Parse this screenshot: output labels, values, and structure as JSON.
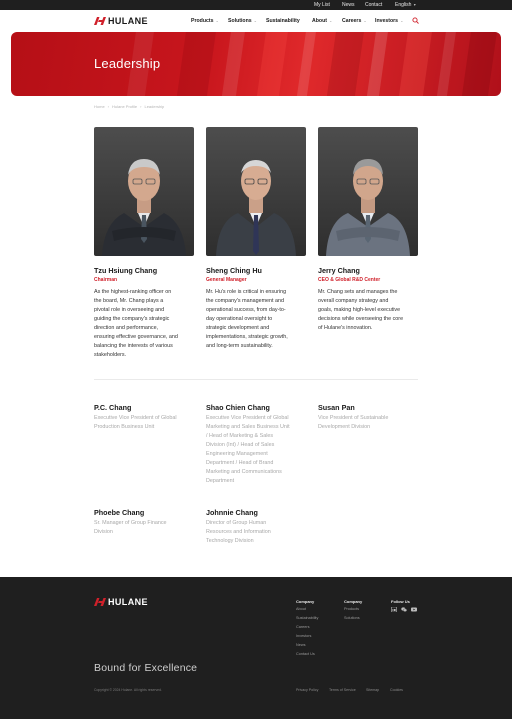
{
  "utility_bar": {
    "links": [
      "My List",
      "News",
      "Contact"
    ],
    "language": "English"
  },
  "brand": {
    "logo_text": "HULANE",
    "accent": "#d0202a"
  },
  "nav": {
    "items": [
      {
        "label": "Products",
        "has_menu": true
      },
      {
        "label": "Solutions",
        "has_menu": true
      },
      {
        "label": "Sustainability",
        "has_menu": false
      },
      {
        "label": "About",
        "has_menu": true
      },
      {
        "label": "Careers",
        "has_menu": true
      },
      {
        "label": "Investors",
        "has_menu": true
      }
    ],
    "search_icon": "search-icon"
  },
  "hero": {
    "title": "Leadership"
  },
  "breadcrumb": [
    "Home",
    "Hulane Profile",
    "Leadership"
  ],
  "leaders": [
    {
      "name": "Tzu Hsiung Chang",
      "role": "Chairman",
      "description_lines": [
        "As the highest-ranking officer on",
        "the board, Mr. Chang plays a",
        "pivotal role in overseeing and",
        "guiding the company's strategic",
        "direction and performance,",
        "ensuring effective governance, and",
        "balancing the interests of various",
        "stakeholders."
      ]
    },
    {
      "name": "Sheng Ching Hu",
      "role": "General Manager",
      "description_lines": [
        "Mr. Hu's role is critical in ensuring",
        "the company's management and",
        "operational success, from day-to-",
        "day operational oversight to",
        "strategic development and",
        "implementations, strategic growth,",
        "and long-term sustainability."
      ]
    },
    {
      "name": "Jerry Chang",
      "role": "CEO & Global R&D Center",
      "description_lines": [
        "Mr. Chang sets and manages the",
        "overall company strategy and",
        "goals, making high-level executive",
        "decisions while overseeing the core",
        "of Hulane's innovation."
      ]
    }
  ],
  "executives": [
    {
      "name": "P.C. Chang",
      "title_lines": [
        "Executive Vice President of Global",
        "Production Business Unit"
      ]
    },
    {
      "name": "Shao Chien Chang",
      "title_lines": [
        "Executive Vice President of Global",
        "Marketing and Sales Business Unit",
        "/ Head of Marketing & Sales",
        "Division (Int) / Head of Sales",
        "Engineering Management",
        "Department / Head of Brand",
        "Marketing and Communications",
        "Department"
      ]
    },
    {
      "name": "Susan Pan",
      "title_lines": [
        "Vice President of Sustainable",
        "Development Division"
      ]
    },
    {
      "name": "Phoebe Chang",
      "title_lines": [
        "Sr. Manager of Group Finance",
        "Division"
      ]
    },
    {
      "name": "Johnnie Chang",
      "title_lines": [
        "Director of Group Human",
        "Resources and Information",
        "Technology Division"
      ]
    }
  ],
  "footer": {
    "logo_text": "HULANE",
    "columns": [
      {
        "heading": "Company",
        "items": [
          "About",
          "Sustainability",
          "Careers",
          "Investors",
          "News",
          "Contact Us"
        ]
      },
      {
        "heading": "Company",
        "items": [
          "Products",
          "Solutions"
        ]
      },
      {
        "heading": "Follow Us",
        "items": []
      }
    ],
    "social_icons": [
      "linkedin-icon",
      "wechat-icon",
      "youtube-icon"
    ],
    "tagline": "Bound for Excellence",
    "copyright": "Copyright © 2024 Hulane. All rights reserved.",
    "legal_links": [
      "Privacy Policy",
      "Terms of Service",
      "Sitemap",
      "Cookies"
    ]
  }
}
